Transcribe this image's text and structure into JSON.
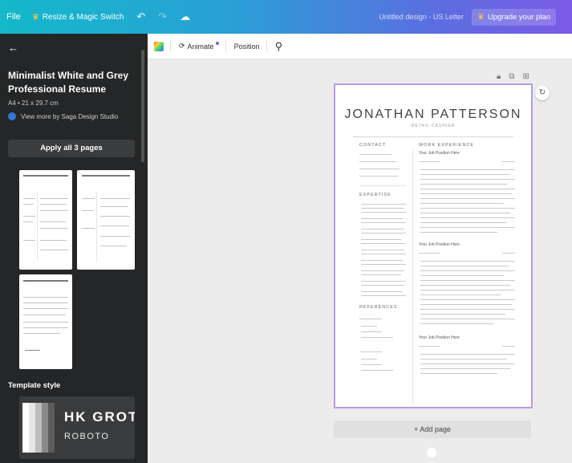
{
  "topbar": {
    "file_label": "File",
    "resize_label": "Resize & Magic Switch",
    "undo_icon": "undo-icon",
    "redo_icon": "redo-icon",
    "cloud_icon": "cloud-sync-icon",
    "document_title": "Untitled design - US Letter",
    "upgrade_label": "Upgrade your plan"
  },
  "sidebar": {
    "template_title": "Minimalist White and Grey Professional Resume",
    "template_size": "A4 • 21 x 29.7 cm",
    "author_text": "View more by Saga Design Studio",
    "apply_label": "Apply all 3 pages",
    "template_style_label": "Template style",
    "style_font_primary": "HK GROTE",
    "style_font_secondary": "ROBOTO",
    "swatch_colors": [
      "#ffffff",
      "#e6e6e6",
      "#bdbdbd",
      "#8a8a8a",
      "#5c5c5c"
    ],
    "thumbnails": [
      "page-1",
      "page-2",
      "page-3"
    ]
  },
  "toolbar": {
    "animate_label": "Animate",
    "position_label": "Position"
  },
  "resume": {
    "name": "JONATHAN PATTERSON",
    "role": "RETAIL CASHIER",
    "contact_heading": "CONTACT",
    "experience_heading": "WORK EXPERIENCE",
    "expertise_heading": "EXPERTISE",
    "references_heading": "REFERENCES",
    "job1": "Your Job Position Here",
    "job2": "Your Job Position Here",
    "job3": "Your Job Position Here"
  },
  "canvas": {
    "add_page_label": "+ Add page"
  },
  "colors": {
    "accent": "#7b5be6",
    "sidebar_bg": "#252627",
    "page_border": "#b79be8"
  }
}
